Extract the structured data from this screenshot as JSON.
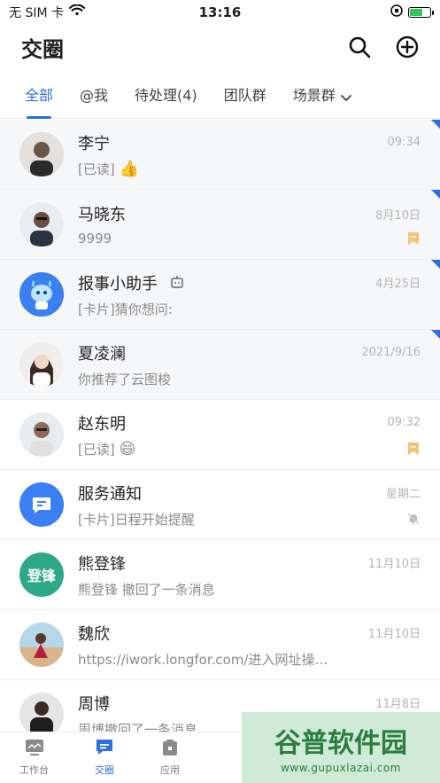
{
  "status_bar": {
    "carrier": "无 SIM 卡",
    "time": "13:16"
  },
  "header": {
    "title": "交圈"
  },
  "tabs": [
    {
      "label": "全部",
      "active": true
    },
    {
      "label": "@我",
      "active": false
    },
    {
      "label": "待处理(4)",
      "active": false
    },
    {
      "label": "团队群",
      "active": false
    },
    {
      "label": "场景群",
      "active": false
    }
  ],
  "conversations": [
    {
      "name": "李宁",
      "time": "09:34",
      "preview": "[已读] ",
      "emoji": "👍",
      "pinned": true,
      "badge_corner": true
    },
    {
      "name": "马晓东",
      "time": "8月10日",
      "preview": "9999",
      "pinned": true,
      "badge_corner": true,
      "status_icon": "bookmark-icon"
    },
    {
      "name": "报事小助手",
      "time": "4月25日",
      "preview": "[卡片]猜你想问:",
      "pinned": true,
      "badge_corner": true,
      "robot": true
    },
    {
      "name": "夏凌澜",
      "time": "2021/9/16",
      "preview": "你推荐了云图梭",
      "pinned": true,
      "badge_corner": true
    },
    {
      "name": "赵东明",
      "time": "09:32",
      "preview": "[已读] ",
      "emoji": "😄",
      "status_icon": "bookmark-icon"
    },
    {
      "name": "服务通知",
      "time": "星期二",
      "preview": "[卡片]日程开始提醒",
      "status_icon": "mute-icon"
    },
    {
      "name": "熊登锋",
      "time": "11月10日",
      "preview": "熊登锋 撤回了一条消息",
      "avatar_text": "登锋"
    },
    {
      "name": "魏欣",
      "time": "11月10日",
      "preview": "https://iwork.longfor.com/进入网址操…"
    },
    {
      "name": "周博",
      "time": "11月8日",
      "preview": "周博撤回了一条消息"
    }
  ],
  "bottom_nav": [
    {
      "label": "工作台",
      "active": false
    },
    {
      "label": "交圈",
      "active": true
    },
    {
      "label": "应用",
      "active": false
    }
  ],
  "watermark": {
    "title": "谷普软件园",
    "url": "www.gupuxlazai.com"
  },
  "colors": {
    "accent": "#2b6fe0",
    "pinned_bg": "#f6f7f9",
    "bookmark": "#f3c37a",
    "service_avatar": "#3b7ff2",
    "team_avatar": "#2ea889"
  }
}
